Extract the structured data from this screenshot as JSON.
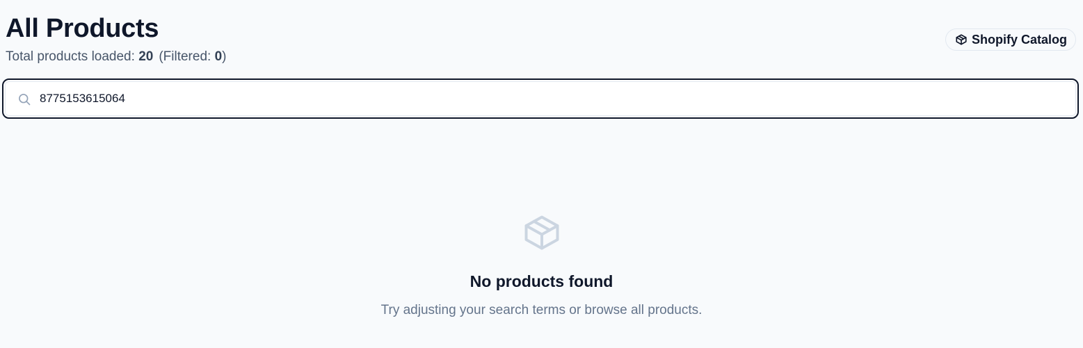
{
  "header": {
    "title": "All Products",
    "stats_prefix": "Total products loaded:",
    "total_loaded": "20",
    "filtered_prefix": "(Filtered:",
    "filtered_count": "0",
    "filtered_suffix": ")"
  },
  "catalog_button": {
    "label": "Shopify Catalog",
    "icon": "package-icon"
  },
  "search": {
    "icon": "search-icon",
    "value": "8775153615064"
  },
  "empty_state": {
    "icon": "package-icon",
    "title": "No products found",
    "subtitle": "Try adjusting your search terms or browse all products."
  },
  "colors": {
    "background": "#f8fafc",
    "text_primary": "#0f172a",
    "text_muted": "#64748b",
    "icon_muted": "#cbd5e1",
    "border_focus": "#0f172a"
  }
}
